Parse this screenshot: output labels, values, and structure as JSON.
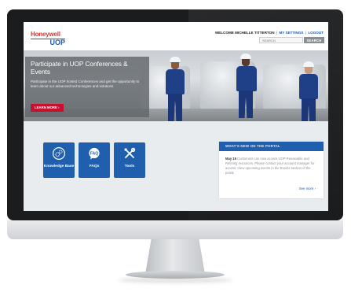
{
  "header": {
    "logo": {
      "brand": "Honeywell",
      "product": "UOP"
    },
    "welcome": "WELCOME MICHELLE TITTERTON",
    "separator": "|",
    "settings_link": "MY SETTINGS",
    "logout_link": "LOGOUT",
    "search": {
      "placeholder": "SEARCH",
      "button_label": "SEARCH"
    }
  },
  "hero": {
    "title": "Participate in UOP Conferences & Events",
    "text": "Participate in the UOP hosted Conferences and get the opportunity to learn about our advanced technologies and solutions",
    "cta_label": "LEARN MORE  ›"
  },
  "quick_links": [
    {
      "label": "Knowledge Base",
      "icon": "knowledge-base-gears-icon"
    },
    {
      "label": "FAQs",
      "icon": "faq-speech-bubble-icon"
    },
    {
      "label": "Tools",
      "icon": "tools-wrench-screwdriver-icon"
    }
  ],
  "news": {
    "header": "WHAT'S NEW ON THE PORTAL",
    "date": "May 15",
    "text": "Customers can now access UOP Renewable and Refining resources. Please contact your account manager for access. View upcoming events in the Events section of the portal.",
    "link_label": "See more  ›"
  },
  "colors": {
    "brand_red": "#e4312b",
    "brand_blue": "#1d5aa8",
    "tile_blue": "#1f5fae",
    "cta_red": "#c8102e"
  }
}
